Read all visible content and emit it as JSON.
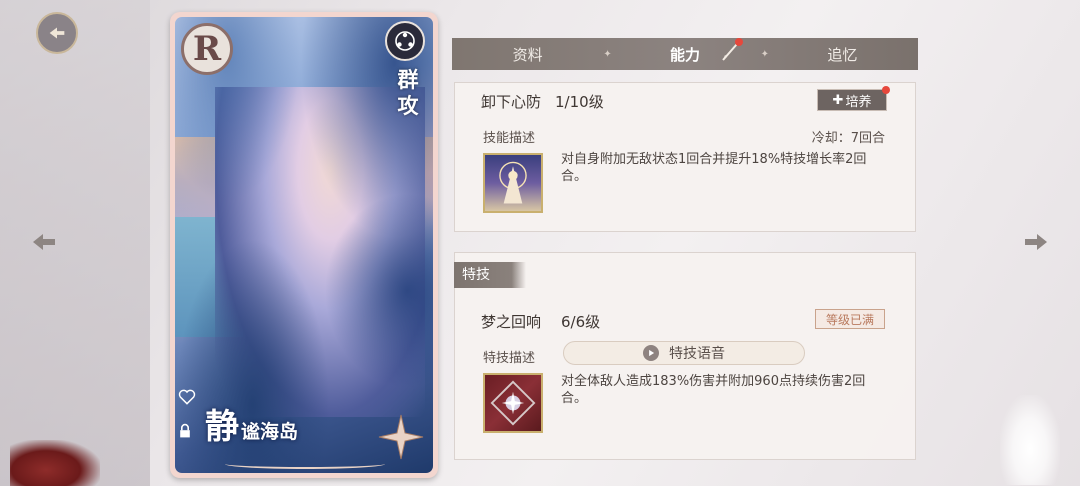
{
  "navigation": {
    "back_icon": "back-arrow-icon",
    "prev_icon": "left-arrow-icon",
    "next_icon": "right-arrow-icon"
  },
  "card": {
    "rarity": "R",
    "type_label": "群攻",
    "name_main": "静",
    "name_sub": "谧海岛",
    "accent_color": "#f3d6cf"
  },
  "tabs": [
    {
      "label": "资料",
      "active": false
    },
    {
      "label": "能力",
      "active": true
    },
    {
      "label": "追忆",
      "active": false
    }
  ],
  "skill": {
    "name": "卸下心防",
    "level": "1/10级",
    "cultivate_label": "培养",
    "desc_label": "技能描述",
    "cooldown": "冷却：7回合",
    "description": "对自身附加无敌状态1回合并提升18%特技增长率2回合。"
  },
  "special": {
    "section_title": "特技",
    "name": "梦之回响",
    "level": "6/6级",
    "max_badge": "等级已满",
    "desc_label": "特技描述",
    "voice_label": "特技语音",
    "description": "对全体敌人造成183%伤害并附加960点持续伤害2回合。"
  }
}
